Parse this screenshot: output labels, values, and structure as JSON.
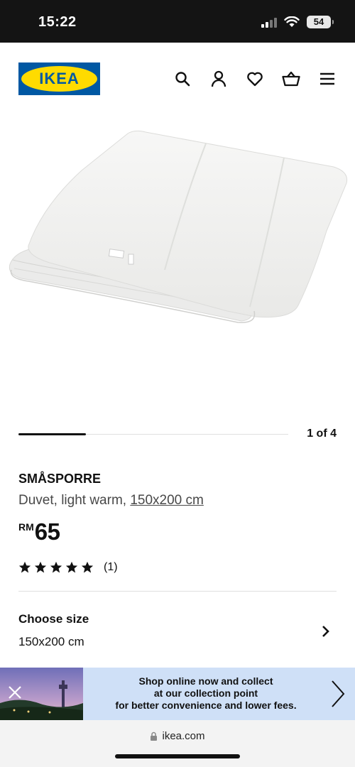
{
  "status_bar": {
    "time": "15:22",
    "battery": "54"
  },
  "header": {
    "logo_text": "IKEA",
    "icons": [
      "search-icon",
      "account-icon",
      "heart-icon",
      "basket-icon",
      "menu-icon"
    ]
  },
  "gallery": {
    "counter": "1 of 4",
    "position": 1,
    "total": 4
  },
  "product": {
    "name": "SMÅSPORRE",
    "description": "Duvet, light warm, ",
    "size_link": "150x200 cm",
    "price_currency": "RM",
    "price_value": "65",
    "rating_stars": 5,
    "rating_count": "(1)"
  },
  "choose_size": {
    "title": "Choose size",
    "value": "150x200 cm"
  },
  "banner": {
    "line1": "Shop online now and collect",
    "line2": "at our collection point",
    "line3": "for better convenience and lower fees."
  },
  "browser": {
    "url": "ikea.com"
  },
  "colors": {
    "ikea_blue": "#0058a3",
    "ikea_yellow": "#ffdb00",
    "banner_bg": "#cfe0f7"
  }
}
